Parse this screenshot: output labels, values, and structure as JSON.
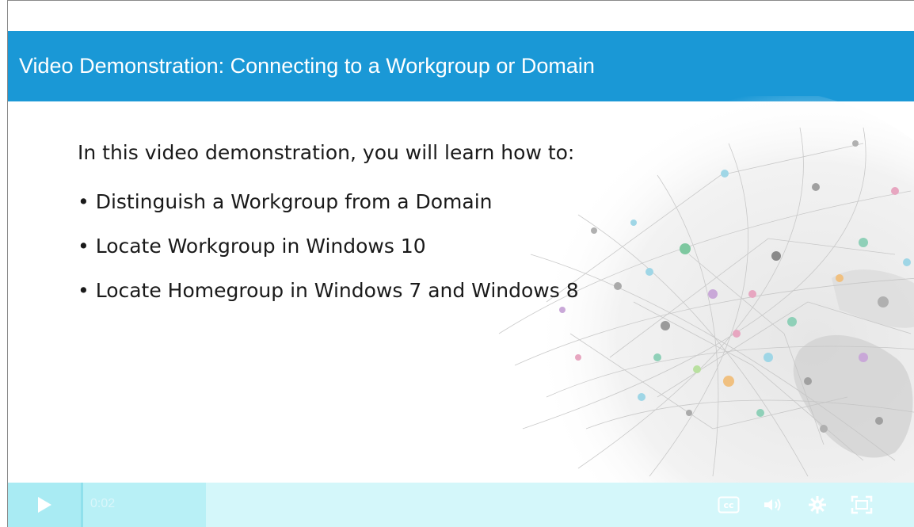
{
  "slide": {
    "title": "Video Demonstration: Connecting to a Workgroup or Domain",
    "intro": "In this video demonstration, you will learn how to:",
    "bullets": [
      "Distinguish a Workgroup from a Domain",
      "Locate Workgroup in Windows 10",
      "Locate Homegroup in Windows 7 and Windows 8"
    ]
  },
  "player": {
    "current_time": "0:02",
    "progress": 0.2,
    "icons": [
      "play-icon",
      "closed-captions-icon",
      "volume-icon",
      "settings-icon",
      "fullscreen-icon"
    ],
    "cc_label": "cc"
  },
  "colors": {
    "title_bar": "#1a98d6",
    "control_bar": "#d4f7fa",
    "play_button": "#a9ebf3"
  }
}
